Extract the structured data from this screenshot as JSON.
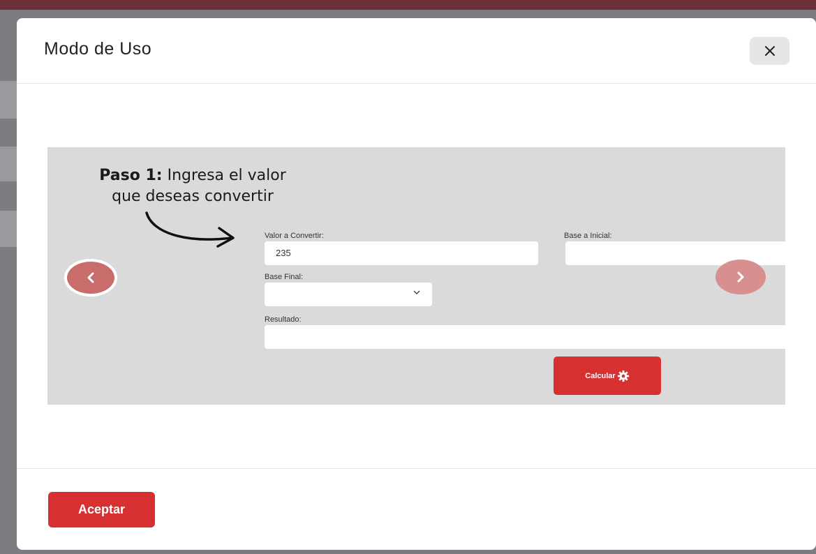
{
  "modal": {
    "title": "Modo de Uso",
    "close_icon": "close-icon"
  },
  "slide": {
    "step_label": "Paso 1:",
    "step_text_line1": "Ingresa el valor",
    "step_text_line2": "que deseas convertir",
    "form": {
      "valor_label": "Valor a Convertir:",
      "valor_value": "235",
      "base_inicial_label": "Base a Inicial:",
      "base_inicial_value": "",
      "base_final_label": "Base Final:",
      "base_final_value": "",
      "resultado_label": "Resultado:",
      "resultado_value": "",
      "calcular_label": "Calcular",
      "calcular_icon": "gear-icon"
    },
    "prev_icon": "chevron-left-icon",
    "next_icon": "chevron-right-icon"
  },
  "footer": {
    "accept_label": "Aceptar"
  },
  "colors": {
    "accent": "#d73030",
    "backdrop_top": "#6e2f36",
    "slide_bg": "#dadada"
  }
}
